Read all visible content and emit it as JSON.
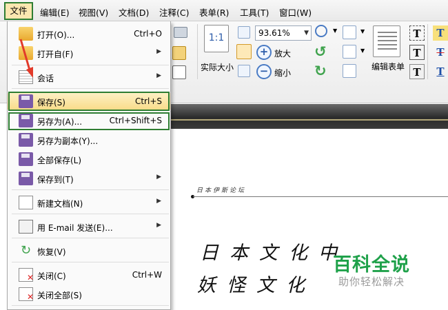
{
  "menubar": {
    "items": [
      "文件",
      "编辑(E)",
      "视图(V)",
      "文档(D)",
      "注释(C)",
      "表单(R)",
      "工具(T)",
      "窗口(W)"
    ]
  },
  "toolbar": {
    "zoom_value": "93.61%",
    "actual_size_label": "实际大小",
    "actual_size_icon_text": "1:1",
    "zoom_in_label": "放大",
    "zoom_out_label": "缩小",
    "edit_form_label": "编辑表单"
  },
  "file_menu": {
    "items": [
      {
        "label": "打开(O)...",
        "shortcut": "Ctrl+O",
        "submenu": false,
        "icon": "folder-open-icon"
      },
      {
        "label": "打开自(F)",
        "shortcut": "",
        "submenu": true,
        "icon": "folder-icon"
      },
      {
        "label": "会话",
        "shortcut": "",
        "submenu": true,
        "icon": "calendar-icon"
      },
      {
        "label": "保存(S)",
        "shortcut": "Ctrl+S",
        "submenu": false,
        "icon": "save-icon",
        "highlighted": true
      },
      {
        "label": "另存为(A)...",
        "shortcut": "Ctrl+Shift+S",
        "submenu": false,
        "icon": "save-as-icon"
      },
      {
        "label": "另存为副本(Y)...",
        "shortcut": "",
        "submenu": false,
        "icon": "save-copy-icon"
      },
      {
        "label": "全部保存(L)",
        "shortcut": "",
        "submenu": false,
        "icon": "save-all-icon"
      },
      {
        "label": "保存到(T)",
        "shortcut": "",
        "submenu": true,
        "icon": "save-to-icon"
      },
      {
        "label": "新建文档(N)",
        "shortcut": "",
        "submenu": true,
        "icon": "new-document-icon"
      },
      {
        "label": "用 E-mail 发送(E)...",
        "shortcut": "",
        "submenu": true,
        "icon": "email-icon"
      },
      {
        "label": "恢复(V)",
        "shortcut": "",
        "submenu": false,
        "icon": "revert-icon"
      },
      {
        "label": "关闭(C)",
        "shortcut": "Ctrl+W",
        "submenu": false,
        "icon": "close-document-icon"
      },
      {
        "label": "关闭全部(S)",
        "shortcut": "",
        "submenu": false,
        "icon": "close-all-icon"
      }
    ]
  },
  "document": {
    "header_text": "日本伊斯论坛",
    "line1": "日本文化中",
    "line2": "妖怪文化"
  },
  "watermark": {
    "title": "百科全说",
    "subtitle": "助你轻松解决"
  },
  "colors": {
    "highlight_outline": "#2e7d32",
    "menu_highlight": "#f9dc8a",
    "watermark_green": "#1fa14a"
  }
}
